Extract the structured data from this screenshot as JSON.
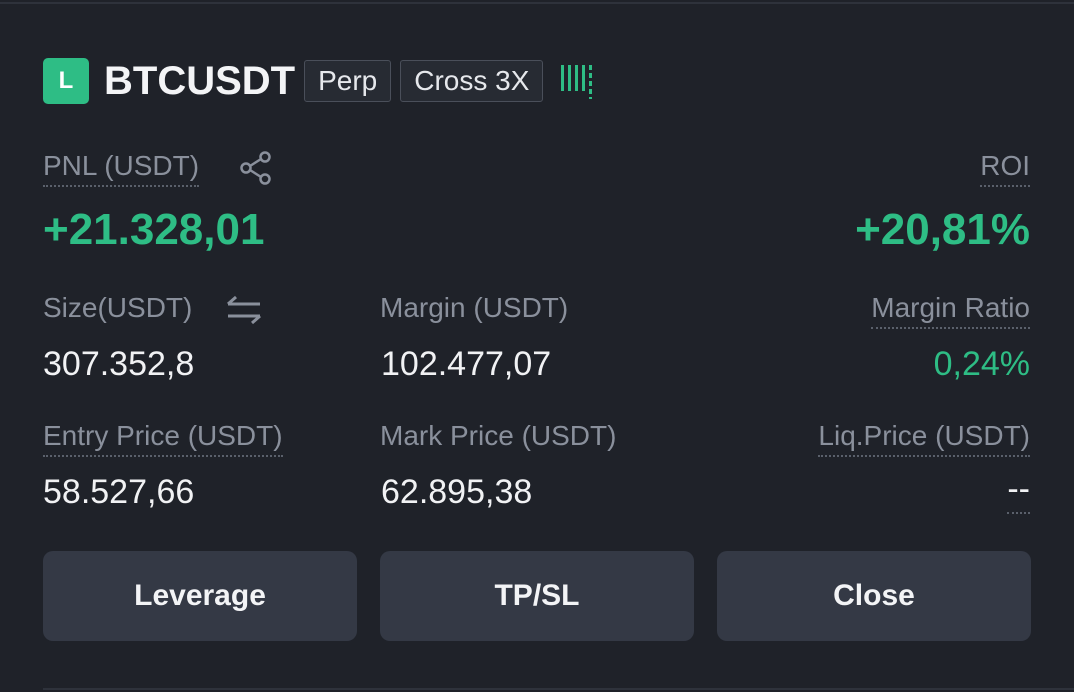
{
  "position": {
    "side_badge": "L",
    "symbol": "BTCUSDT",
    "type_tag": "Perp",
    "margin_tag": "Cross 3X",
    "adl_level": 4
  },
  "pnl": {
    "label": "PNL (USDT)",
    "value": "+21.328,01",
    "share_icon": "share-icon"
  },
  "roi": {
    "label": "ROI",
    "value": "+20,81%"
  },
  "size": {
    "label": "Size(USDT)",
    "value": "307.352,8",
    "swap_icon": "swap-arrows-icon"
  },
  "margin": {
    "label": "Margin (USDT)",
    "value": "102.477,07"
  },
  "margin_ratio": {
    "label": "Margin Ratio",
    "value": "0,24%"
  },
  "entry_price": {
    "label": "Entry Price (USDT)",
    "value": "58.527,66"
  },
  "mark_price": {
    "label": "Mark Price (USDT)",
    "value": "62.895,38"
  },
  "liq_price": {
    "label": "Liq.Price (USDT)",
    "value": "--"
  },
  "actions": {
    "leverage": "Leverage",
    "tpsl": "TP/SL",
    "close": "Close"
  },
  "colors": {
    "background": "#1f2229",
    "profit_green": "#2ebd85",
    "button_bg": "#343945",
    "label_gray": "#8a909c"
  }
}
